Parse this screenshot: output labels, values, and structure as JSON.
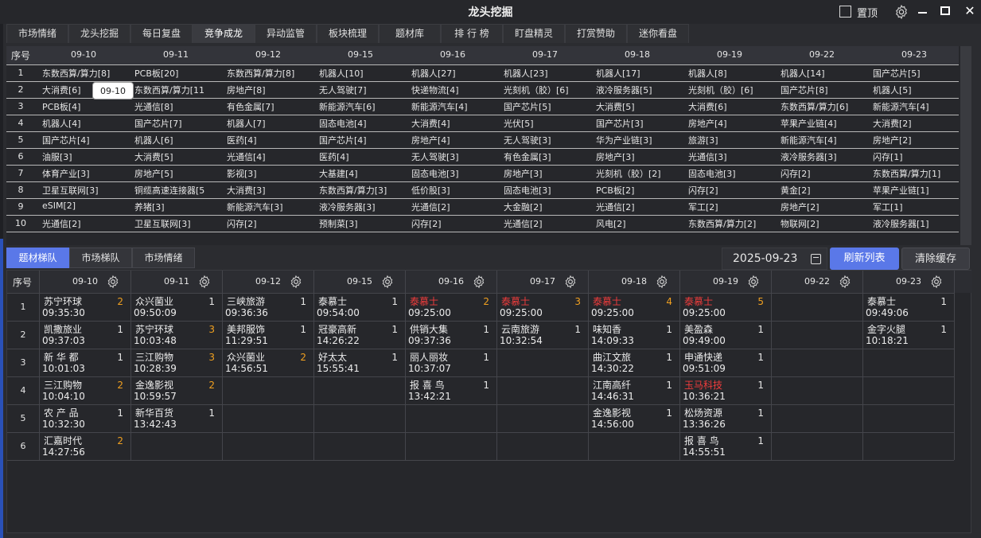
{
  "app": {
    "title": "龙头挖掘",
    "pin_label": "置顶"
  },
  "tabs": [
    "市场情绪",
    "龙头挖掘",
    "每日复盘",
    "竞争成龙",
    "异动监管",
    "板块梳理",
    "题材库",
    "排 行 榜",
    "盯盘精灵",
    "打赏赞助",
    "迷你看盘"
  ],
  "active_tab": "竞争成龙",
  "upper": {
    "seq_label": "序号",
    "dates": [
      "09-10",
      "09-11",
      "09-12",
      "09-15",
      "09-16",
      "09-17",
      "09-18",
      "09-19",
      "09-22",
      "09-23"
    ],
    "tooltip": "09-10",
    "rows": [
      [
        "东数西算/算力[8]",
        "PCB板[20]",
        "东数西算/算力[8]",
        "机器人[10]",
        "机器人[27]",
        "机器人[23]",
        "机器人[17]",
        "机器人[8]",
        "机器人[14]",
        "国产芯片[5]"
      ],
      [
        "大消费[6]",
        "东数西算/算力[11",
        "房地产[8]",
        "无人驾驶[7]",
        "快递物流[4]",
        "光刻机（胶）[6]",
        "液冷服务器[5]",
        "光刻机（胶）[6]",
        "国产芯片[8]",
        "机器人[5]"
      ],
      [
        "PCB板[4]",
        "光通信[8]",
        "有色金属[7]",
        "新能源汽车[6]",
        "新能源汽车[4]",
        "国产芯片[5]",
        "大消费[5]",
        "大消费[6]",
        "东数西算/算力[6]",
        "新能源汽车[4]"
      ],
      [
        "机器人[4]",
        "国产芯片[7]",
        "机器人[7]",
        "固态电池[4]",
        "大消费[4]",
        "光伏[5]",
        "国产芯片[3]",
        "房地产[4]",
        "苹果产业链[4]",
        "大消费[2]"
      ],
      [
        "国产芯片[4]",
        "机器人[6]",
        "医药[4]",
        "国产芯片[4]",
        "房地产[4]",
        "无人驾驶[3]",
        "华为产业链[3]",
        "旅游[3]",
        "新能源汽车[4]",
        "房地产[2]"
      ],
      [
        "油服[3]",
        "大消费[5]",
        "光通信[4]",
        "医药[4]",
        "无人驾驶[3]",
        "有色金属[3]",
        "房地产[3]",
        "光通信[3]",
        "液冷服务器[3]",
        "闪存[1]"
      ],
      [
        "体育产业[3]",
        "房地产[5]",
        "影视[3]",
        "大基建[4]",
        "固态电池[3]",
        "房地产[3]",
        "光刻机（胶）[2]",
        "固态电池[3]",
        "闪存[2]",
        "东数西算/算力[1]"
      ],
      [
        "卫星互联网[3]",
        "铜缆高速连接器[5",
        "大消费[3]",
        "东数西算/算力[3]",
        "低价股[3]",
        "固态电池[3]",
        "PCB板[2]",
        "闪存[2]",
        "黄金[2]",
        "苹果产业链[1]"
      ],
      [
        "eSIM[2]",
        "养猪[3]",
        "新能源汽车[3]",
        "液冷服务器[3]",
        "光通信[2]",
        "大金融[2]",
        "光通信[2]",
        "军工[2]",
        "房地产[2]",
        "军工[1]"
      ],
      [
        "光通信[2]",
        "卫星互联网[3]",
        "闪存[2]",
        "预制菜[3]",
        "闪存[2]",
        "光通信[2]",
        "风电[2]",
        "东数西算/算力[2]",
        "物联网[2]",
        "液冷服务器[1]"
      ]
    ]
  },
  "subtabs": [
    "题材梯队",
    "市场梯队",
    "市场情绪"
  ],
  "active_subtab": "题材梯队",
  "date_value": "2025-09-23",
  "buttons": {
    "refresh": "刷新列表",
    "clear": "清除缓存"
  },
  "lower": {
    "seq_label": "序号",
    "dates": [
      "09-10",
      "09-11",
      "09-12",
      "09-15",
      "09-16",
      "09-17",
      "09-18",
      "09-19",
      "09-22",
      "09-23"
    ],
    "row_numbers": [
      "1",
      "2",
      "3",
      "4",
      "5",
      "6"
    ],
    "columns": [
      [
        {
          "name": "苏宁环球",
          "time": "09:35:30",
          "count": "2",
          "hl": "orange"
        },
        {
          "name": "凯撒旅业",
          "time": "09:37:03",
          "count": "1"
        },
        {
          "name": "新 华 都",
          "time": "10:01:03",
          "count": "1"
        },
        {
          "name": "三江购物",
          "time": "10:04:10",
          "count": "2",
          "hl": "orange"
        },
        {
          "name": "农 产 品",
          "time": "10:32:30",
          "count": "1"
        },
        {
          "name": "汇嘉时代",
          "time": "14:27:56",
          "count": "2",
          "hl": "orange"
        }
      ],
      [
        {
          "name": "众兴菌业",
          "time": "09:50:09",
          "count": "1"
        },
        {
          "name": "苏宁环球",
          "time": "10:03:48",
          "count": "3",
          "hl": "orange"
        },
        {
          "name": "三江购物",
          "time": "10:28:39",
          "count": "3",
          "hl": "orange"
        },
        {
          "name": "金逸影视",
          "time": "10:59:57",
          "count": "2",
          "hl": "orange"
        },
        {
          "name": "新华百货",
          "time": "13:42:43",
          "count": "1"
        }
      ],
      [
        {
          "name": "三峡旅游",
          "time": "09:36:36",
          "count": "1"
        },
        {
          "name": "美邦服饰",
          "time": "11:29:51",
          "count": "1"
        },
        {
          "name": "众兴菌业",
          "time": "14:56:51",
          "count": "2",
          "hl": "orange"
        }
      ],
      [
        {
          "name": "泰慕士",
          "time": "09:54:00",
          "count": "1"
        },
        {
          "name": "冠豪高新",
          "time": "14:26:22",
          "count": "1"
        },
        {
          "name": "好太太",
          "time": "15:55:41",
          "count": "1"
        }
      ],
      [
        {
          "name": "泰慕士",
          "time": "09:25:00",
          "count": "2",
          "hl": "orange",
          "red": true
        },
        {
          "name": "供销大集",
          "time": "09:37:36",
          "count": "1"
        },
        {
          "name": "丽人丽妆",
          "time": "10:37:07",
          "count": "1"
        },
        {
          "name": "报 喜 鸟",
          "time": "13:42:21",
          "count": "1"
        }
      ],
      [
        {
          "name": "泰慕士",
          "time": "09:25:00",
          "count": "3",
          "hl": "orange",
          "red": true
        },
        {
          "name": "云南旅游",
          "time": "10:32:54",
          "count": "1"
        }
      ],
      [
        {
          "name": "泰慕士",
          "time": "09:25:00",
          "count": "4",
          "hl": "orange",
          "red": true
        },
        {
          "name": "味知香",
          "time": "14:09:33",
          "count": "1"
        },
        {
          "name": "曲江文旅",
          "time": "14:30:22",
          "count": "1"
        },
        {
          "name": "江南高纤",
          "time": "14:46:31",
          "count": "1"
        },
        {
          "name": "金逸影视",
          "time": "14:56:00",
          "count": "1"
        }
      ],
      [
        {
          "name": "泰慕士",
          "time": "09:25:00",
          "count": "5",
          "hl": "orange",
          "red": true
        },
        {
          "name": "美盈森",
          "time": "09:49:00",
          "count": "1"
        },
        {
          "name": "申通快递",
          "time": "09:51:09",
          "count": "1"
        },
        {
          "name": "玉马科技",
          "time": "10:36:21",
          "count": "1",
          "red": true
        },
        {
          "name": "松炀资源",
          "time": "13:36:26",
          "count": "1"
        },
        {
          "name": "报 喜 鸟",
          "time": "14:55:51",
          "count": "1"
        }
      ],
      [],
      [
        {
          "name": "泰慕士",
          "time": "09:49:06",
          "count": "1"
        },
        {
          "name": "金字火腿",
          "time": "10:18:21",
          "count": "1"
        }
      ]
    ]
  },
  "colors": {
    "accent": "#5a78e8",
    "red": "#f03c3c",
    "orange": "#f0a020",
    "bg": "#26272b"
  }
}
